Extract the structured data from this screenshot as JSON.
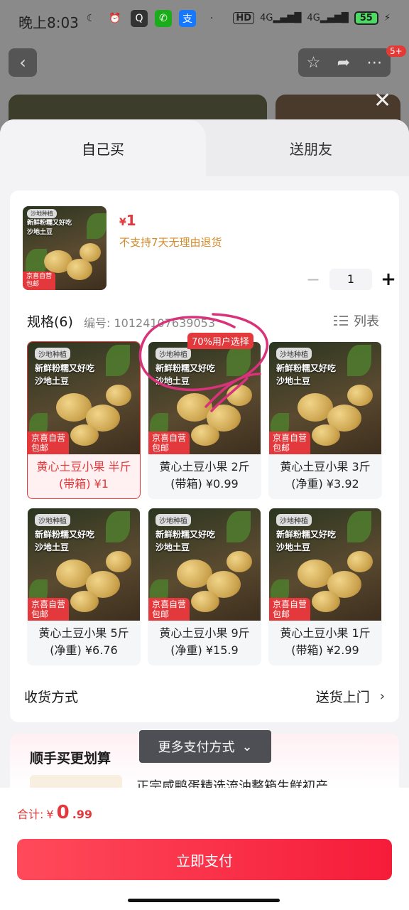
{
  "status_bar": {
    "time": "晚上8:03",
    "network": "4G",
    "battery": "55",
    "notification_count": "5+"
  },
  "tabs": {
    "self_buy": "自己买",
    "gift_friend": "送朋友"
  },
  "product": {
    "price_symbol": "¥",
    "price": "1",
    "return_policy": "不支持7天无理由退货",
    "quantity": "1",
    "image_tag": "沙地种植",
    "image_text_line1": "新鲜粉糯又好吃",
    "image_text_line2": "沙地土豆",
    "image_badge_line1": "京喜自营",
    "image_badge_line2": "包邮"
  },
  "spec": {
    "title": "规格(6)",
    "number": "编号: 10124107639053",
    "list_label": "列表",
    "popular_tag": "70%用户选择",
    "items": [
      {
        "name": "黄心土豆小果 半斤(带箱) ¥1",
        "selected": true
      },
      {
        "name": "黄心土豆小果 2斤(带箱) ¥0.99",
        "selected": false
      },
      {
        "name": "黄心土豆小果 3斤(净重) ¥3.92",
        "selected": false
      },
      {
        "name": "黄心土豆小果 5斤(净重) ¥6.76",
        "selected": false
      },
      {
        "name": "黄心土豆小果 9斤(净重) ¥15.9",
        "selected": false
      },
      {
        "name": "黄心土豆小果 1斤(带箱) ¥2.99",
        "selected": false
      }
    ]
  },
  "shipping": {
    "label": "收货方式",
    "value": "送货上门"
  },
  "extra": {
    "title": "顺手买更划算",
    "item_text": "正宗咸鸭蛋精选流油整箱生鲜初产"
  },
  "more_pay": "更多支付方式",
  "footer": {
    "total_label": "合计:",
    "total_symbol": "¥",
    "total_int": "0",
    "total_dec": ".99",
    "pay_button": "立即支付"
  },
  "colors": {
    "accent": "#e4393c",
    "annotation": "#d8337a"
  }
}
